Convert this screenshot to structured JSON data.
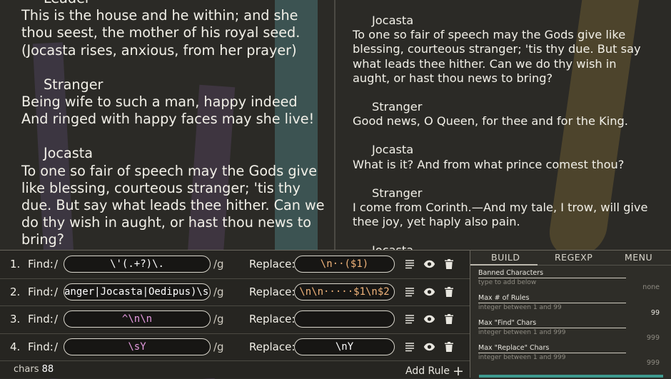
{
  "reader": {
    "left": [
      {
        "speaker": "Leader",
        "text": "This is the house and he within; and she\nthou seest, the mother of his royal seed.\n    (Jocasta rises, anxious, from her prayer)"
      },
      {
        "speaker": "Stranger",
        "text": "Being wife to such a man, happy indeed\nAnd ringed with happy faces may she live!"
      },
      {
        "speaker": "Jocasta",
        "text": "To one so fair of speech may the Gods give\nlike blessing, courteous stranger; 'tis thy\ndue. But say what leads thee hither. Can we\ndo thy wish in aught, or hast thou news to\nbring?"
      }
    ],
    "right": [
      {
        "speaker": "Jocasta",
        "text": "To one so fair of speech may the Gods give like\nblessing, courteous stranger; 'tis thy due. But say\nwhat leads thee hither. Can we do thy wish in\naught, or hast thou news to bring?"
      },
      {
        "speaker": "Stranger",
        "text": "Good news, O Queen, for thee and for the King."
      },
      {
        "speaker": "Jocasta",
        "text": "What is it? And from what prince comest thou?"
      },
      {
        "speaker": "Stranger",
        "text": "I come from Corinth.—And my tale, I trow, will give\nthee joy, yet haply also pain."
      },
      {
        "speaker": "Jocasta",
        "text": ""
      }
    ]
  },
  "rules": {
    "find_label": "Find:",
    "replace_label": "Replace:",
    "slash": "/",
    "flag": "/g",
    "items": [
      {
        "num": "1.",
        "find": "\\'(.+?)\\.",
        "replace": "\\n··($1)"
      },
      {
        "num": "2.",
        "find": "anger|Jocasta|Oedipus)\\s(",
        "replace": "\\n\\n·····$1\\n$2"
      },
      {
        "num": "3.",
        "find": "^\\n\\n",
        "replace": ""
      },
      {
        "num": "4.",
        "find": "\\sY",
        "replace": "\\nY"
      }
    ],
    "chars_label": "chars",
    "chars_count": "88",
    "add_rule_label": "Add Rule"
  },
  "panel": {
    "tabs": [
      "BUILD",
      "REGEXP",
      "MENU"
    ],
    "active_tab": "BUILD",
    "fields": [
      {
        "label": "Banned Characters",
        "hint": "type to add below",
        "value": "none"
      },
      {
        "label": "Max # of Rules",
        "hint": "integer between 1 and 99",
        "value": "99"
      },
      {
        "label": "Max \"Find\" Chars",
        "hint": "integer between 1 and 999",
        "value": "999"
      },
      {
        "label": "Max \"Replace\" Chars",
        "hint": "integer between 1 and 999",
        "value": "999"
      }
    ]
  },
  "colors": {
    "background": "#2b2a26",
    "accent_purple": "#e59be0",
    "accent_orange": "#f0b37a",
    "accent_teal": "#3e9a8f"
  },
  "icons": [
    "list-icon",
    "eye-icon",
    "trash-icon",
    "plus-icon"
  ]
}
